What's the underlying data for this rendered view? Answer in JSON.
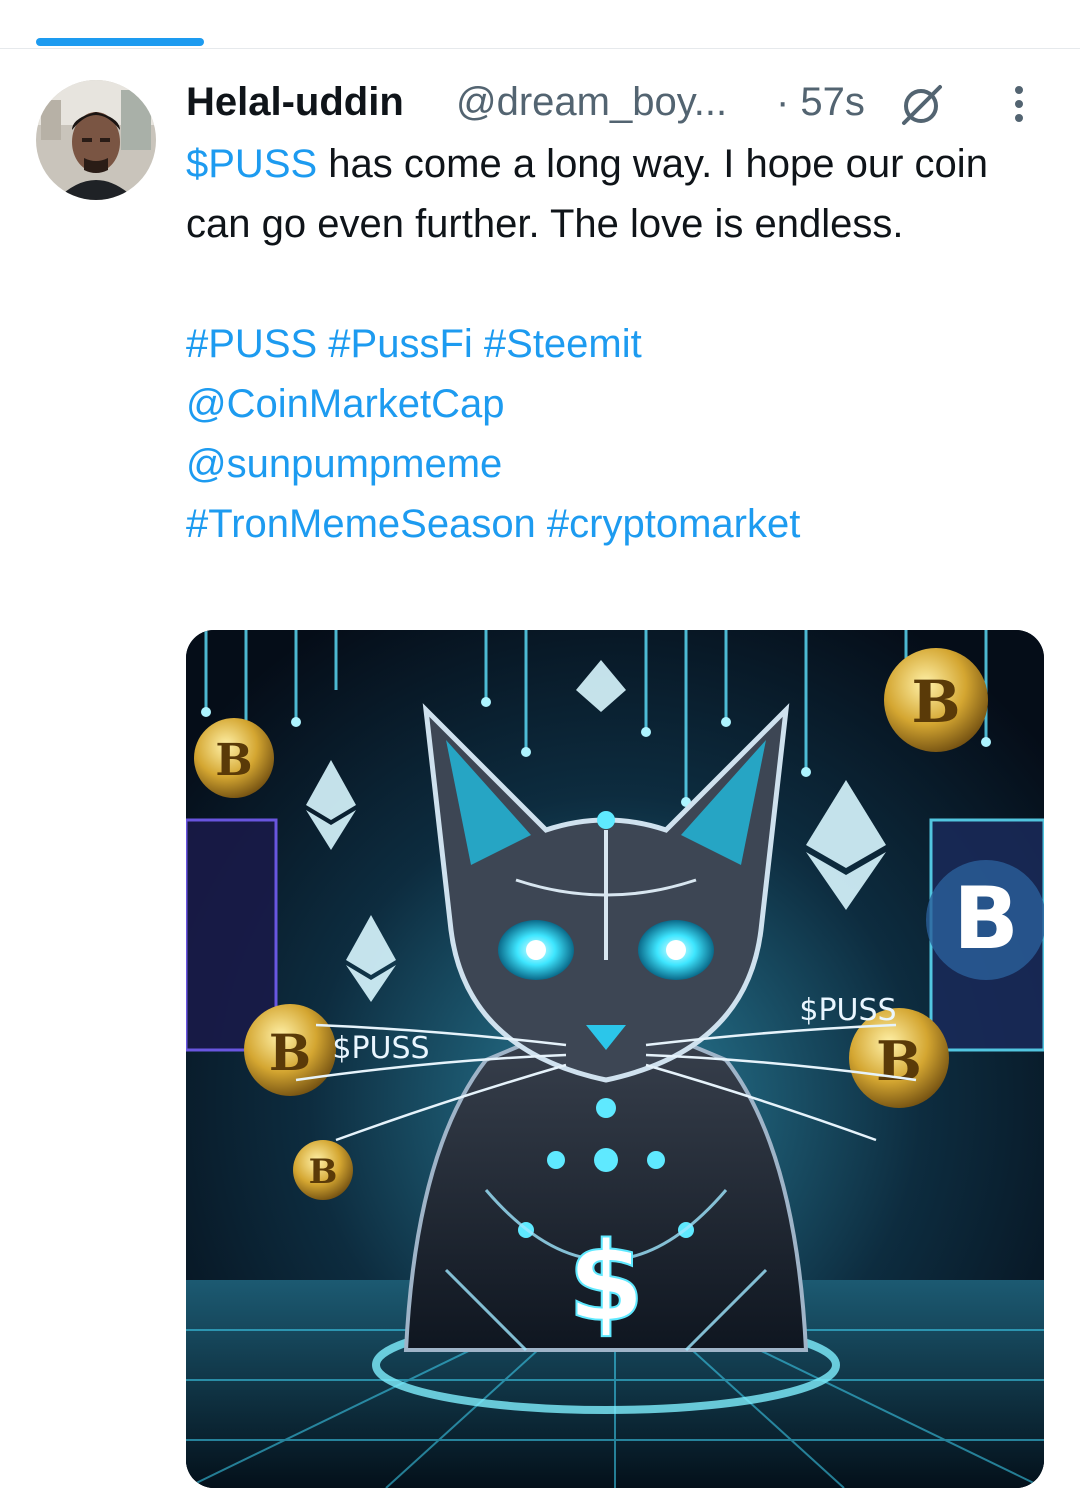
{
  "tweet": {
    "author": {
      "display_name": "Helal-uddin",
      "handle": "@dream_boy...",
      "avatar_icon": "avatar-photo"
    },
    "timestamp": "· 57s",
    "body": {
      "line1_mention": "$PUSS",
      "line1_text": " has come a long way. I hope our coin can go even further. The love is endless.",
      "hashtags_line1": "#PUSS #PussFi #Steemit",
      "mention1": "@CoinMarketCap",
      "mention2": "@sunpumpmeme",
      "hashtags_line2": "#TronMemeSeason #cryptomarket"
    },
    "media": {
      "label_left": "$PUSS",
      "label_right": "$PUSS",
      "center_symbol": "$",
      "coin_symbol": "B"
    }
  },
  "colors": {
    "accent": "#1d9bf0",
    "text": "#0f1419",
    "secondary": "#536471"
  }
}
